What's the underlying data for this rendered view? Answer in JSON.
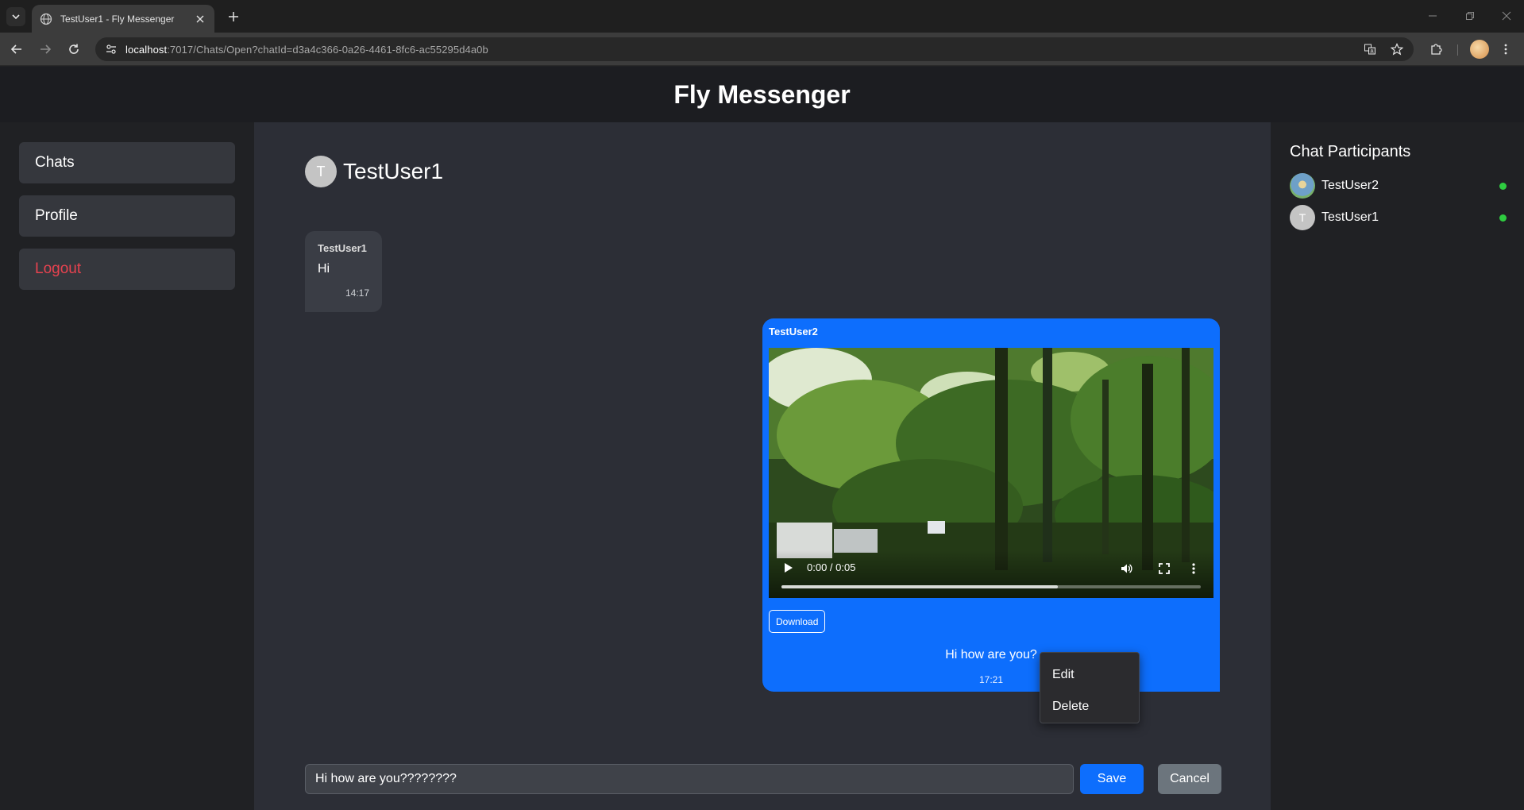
{
  "browser": {
    "tab_title": "TestUser1 - Fly Messenger",
    "url_host": "localhost",
    "url_path": ":7017/Chats/Open?chatId=d3a4c366-0a26-4461-8fc6-ac55295d4a0b"
  },
  "app": {
    "title": "Fly Messenger"
  },
  "sidebar": {
    "items": [
      {
        "label": "Chats"
      },
      {
        "label": "Profile"
      },
      {
        "label": "Logout"
      }
    ]
  },
  "chat": {
    "partner_initial": "T",
    "partner_name": "TestUser1",
    "messages": [
      {
        "sender": "TestUser1",
        "text": "Hi",
        "time": "14:17"
      },
      {
        "sender": "TestUser2",
        "video": {
          "time_display": "0:00 / 0:05",
          "buffered_fraction": 0.66
        },
        "download_label": "Download",
        "text": "Hi how are you?",
        "time": "17:21"
      }
    ]
  },
  "context_menu": {
    "items": [
      {
        "label": "Edit"
      },
      {
        "label": "Delete"
      }
    ]
  },
  "composer": {
    "value": "Hi how are you????????",
    "save_label": "Save",
    "cancel_label": "Cancel"
  },
  "participants": {
    "title": "Chat Participants",
    "list": [
      {
        "name": "TestUser2",
        "initial": "",
        "online": true
      },
      {
        "name": "TestUser1",
        "initial": "T",
        "online": true
      }
    ]
  },
  "colors": {
    "accent": "#0d6efd",
    "logout": "#e8424f",
    "online": "#2ecc40"
  }
}
